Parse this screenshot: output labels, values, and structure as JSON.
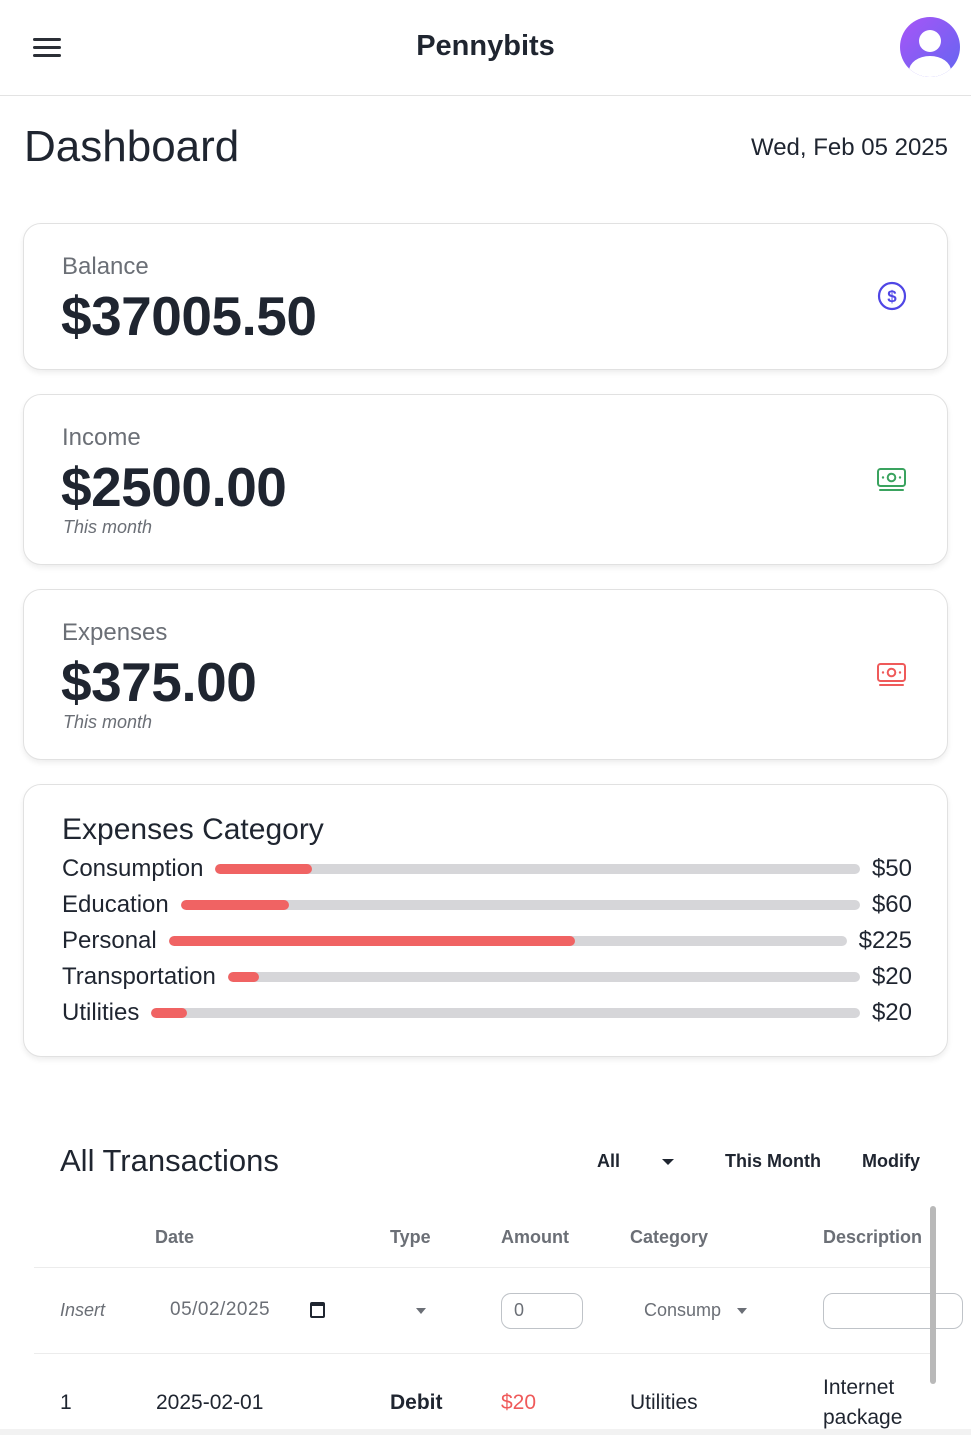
{
  "header": {
    "brand": "Pennybits",
    "menu_icon": "hamburger-menu-icon",
    "avatar_icon": "user-avatar-icon"
  },
  "page": {
    "title": "Dashboard",
    "date": "Wed, Feb 05 2025"
  },
  "cards": {
    "balance": {
      "label": "Balance",
      "value": "$37005.50",
      "icon": "dollar-circle-icon",
      "icon_color": "#4f46e5"
    },
    "income": {
      "label": "Income",
      "value": "$2500.00",
      "sub": "This month",
      "icon": "cash-icon",
      "icon_color": "#3aa35f"
    },
    "expenses": {
      "label": "Expenses",
      "value": "$375.00",
      "sub": "This month",
      "icon": "cash-icon",
      "icon_color": "#ef5a5a"
    }
  },
  "expenses_category": {
    "title": "Expenses Category",
    "items": [
      {
        "name": "Consumption",
        "amount": "$50",
        "fraction": 0.15
      },
      {
        "name": "Education",
        "amount": "$60",
        "fraction": 0.16
      },
      {
        "name": "Personal",
        "amount": "$225",
        "fraction": 0.6
      },
      {
        "name": "Transportation",
        "amount": "$20",
        "fraction": 0.05
      },
      {
        "name": "Utilities",
        "amount": "$20",
        "fraction": 0.05
      }
    ]
  },
  "transactions": {
    "title": "All Transactions",
    "filter_all": "All",
    "filter_period": "This Month",
    "modify": "Modify",
    "columns": [
      "Date",
      "Type",
      "Amount",
      "Category",
      "Description"
    ],
    "insert_row": {
      "label": "Insert",
      "date": "05/02/2025",
      "amount": "0",
      "category": "Consump"
    },
    "rows": [
      {
        "index": "1",
        "date": "2025-02-01",
        "type": "Debit",
        "amount": "$20",
        "category": "Utilities",
        "description_line1": "Internet",
        "description_line2": "package"
      }
    ]
  },
  "colors": {
    "expense_bar": "#f06363",
    "debit_amount": "#ef5a5a"
  }
}
